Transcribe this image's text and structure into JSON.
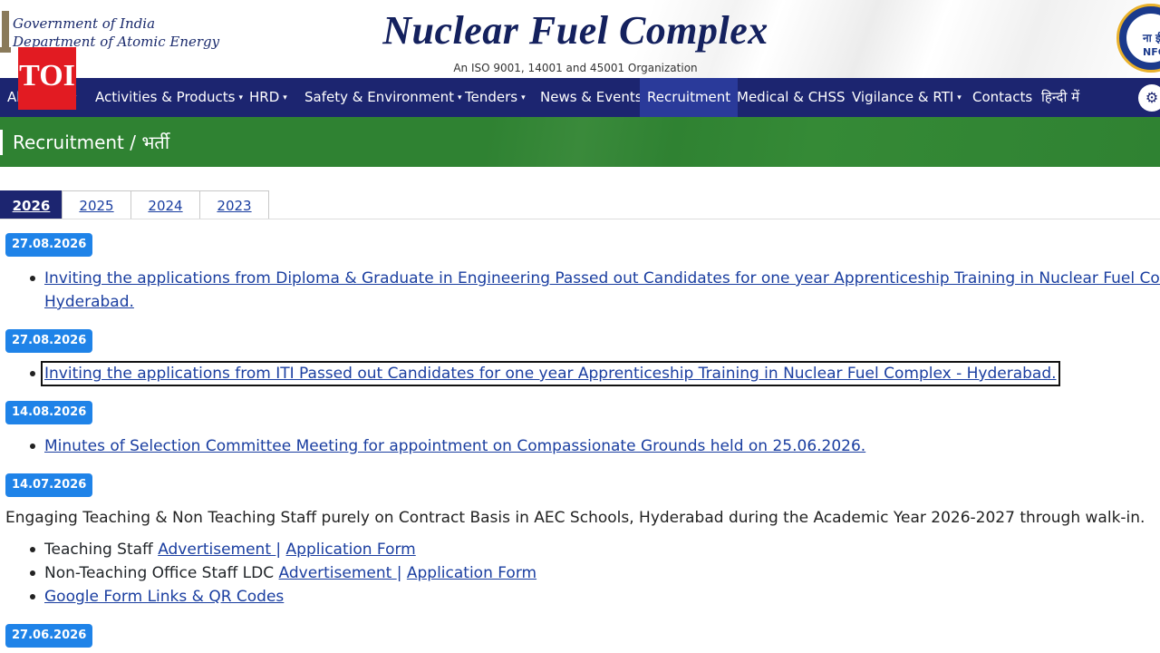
{
  "header": {
    "goi_line1": "Government of India",
    "goi_line2": "Department of Atomic Energy",
    "site_title": "Nuclear Fuel Complex",
    "iso_text": "An ISO 9001, 14001 and 45001 Organization",
    "logo_text_top": "ना ई",
    "logo_text_bottom": "NFC"
  },
  "overlay": {
    "toi_label": "TOI"
  },
  "nav": {
    "items": [
      {
        "label": "About Us",
        "has_caret": true
      },
      {
        "label": "Activities & Products",
        "has_caret": true
      },
      {
        "label": "HRD",
        "has_caret": true
      },
      {
        "label": "Safety & Environment",
        "has_caret": true
      },
      {
        "label": "Tenders",
        "has_caret": true
      },
      {
        "label": "News & Events",
        "has_caret": false
      },
      {
        "label": "Recruitment",
        "has_caret": false,
        "active": true
      },
      {
        "label": "Medical & CHSS",
        "has_caret": false
      },
      {
        "label": "Vigilance & RTI",
        "has_caret": true
      },
      {
        "label": "Contacts",
        "has_caret": false
      },
      {
        "label": "हिन्दी में",
        "has_caret": false
      }
    ],
    "caret_glyph": "▾",
    "settings_icon": "⚙"
  },
  "banner": {
    "title": "Recruitment / भर्ती"
  },
  "tabs": [
    "2026",
    "2025",
    "2024",
    "2023"
  ],
  "entries": [
    {
      "date": "27.08.2026",
      "link_line1": "Inviting the applications from Diploma & Graduate in Engineering Passed out Candidates for one year Apprenticeship Training in Nuclear Fuel Complex -",
      "link_line2": "Hyderabad."
    },
    {
      "date": "27.08.2026",
      "link": "Inviting the applications from ITI Passed out Candidates for one year Apprenticeship Training in Nuclear Fuel Complex - Hyderabad."
    },
    {
      "date": "14.08.2026",
      "link": "Minutes of Selection Committee Meeting for appointment on Compassionate Grounds held on 25.06.2026."
    },
    {
      "date": "14.07.2026",
      "description": "Engaging Teaching & Non Teaching Staff purely on Contract Basis in AEC Schools, Hyderabad during the Academic Year 2026-2027 through walk-in.",
      "teaching_label": "Teaching Staff",
      "nonteaching_label": "Non-Teaching Office Staff LDC",
      "advertisement_label": "Advertisement ",
      "separator": "|",
      "application_form_label": "Application Form",
      "google_form_label": "Google Form Links & QR Codes"
    },
    {
      "date": "27.06.2026"
    }
  ],
  "colors": {
    "nav_bg": "#1c2570",
    "banner_green": "#2f8232",
    "badge_blue": "#1f83e8",
    "link_blue": "#1a3ea0",
    "toi_red": "#e21b22"
  }
}
